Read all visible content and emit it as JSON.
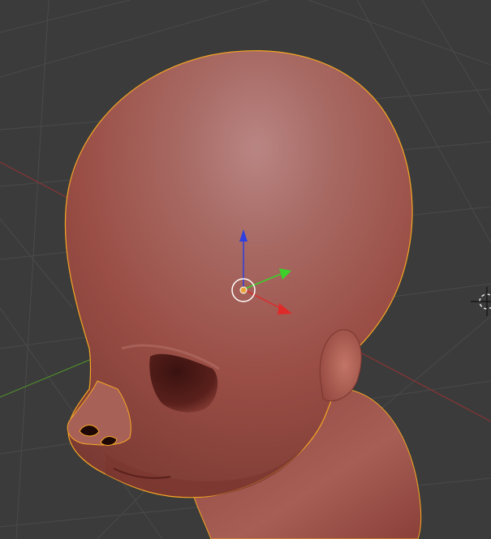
{
  "viewport": {
    "background_color": "#3b3b3b",
    "grid_color": "#4a4a4a",
    "x_axis_color": "#8a3434",
    "y_axis_color": "#4f8a2c"
  },
  "mesh": {
    "object": "head",
    "base_color": "#9a4e45",
    "highlight_color": "#b98583",
    "shadow_color": "#4e1c18",
    "selection_outline_color": "#f5a623"
  },
  "gizmo": {
    "z_arrow_color": "#2e3fe0",
    "y_arrow_color": "#3bd12a",
    "x_arrow_color": "#e02a2a",
    "origin_dot_color": "#e8a33c",
    "pivot_circle_color": "#ffffff"
  },
  "icons": {
    "transform_gizmo": "move-arrows-icon",
    "origin": "object-origin-icon",
    "cursor_3d": "3d-cursor-icon"
  }
}
